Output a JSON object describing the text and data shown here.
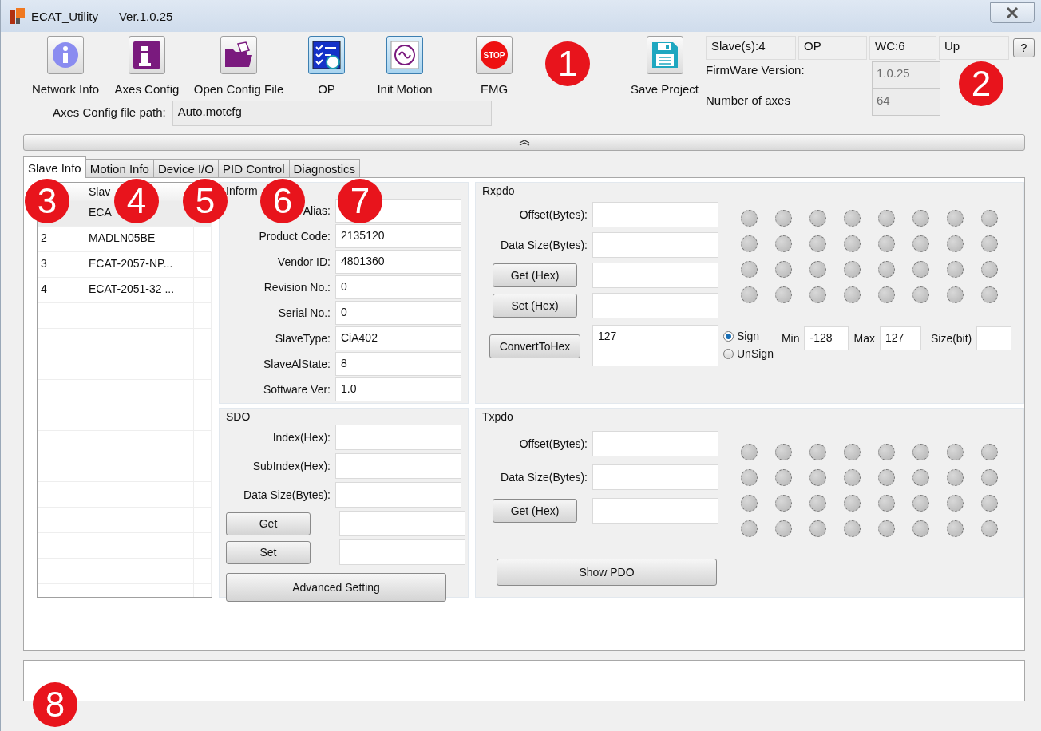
{
  "window": {
    "title": "ECAT_Utility",
    "version": "Ver.1.0.25"
  },
  "toolbar": [
    {
      "label": "Network Info",
      "active": false
    },
    {
      "label": "Axes Config",
      "active": false
    },
    {
      "label": "Open Config File",
      "active": false
    },
    {
      "label": "OP",
      "active": true
    },
    {
      "label": "Init Motion",
      "active": true
    },
    {
      "label": "EMG",
      "icon_text": "STOP",
      "active": false
    }
  ],
  "save": {
    "label": "Save Project"
  },
  "config_path": {
    "label": "Axes Config file path:",
    "value": "Auto.motcfg"
  },
  "status": {
    "cells": [
      "Slave(s):4",
      "OP",
      "WC:6",
      "Up"
    ],
    "help": "?",
    "firmware": {
      "label": "FirmWare Version:",
      "value": "1.0.25",
      "disabled": true
    },
    "axes": {
      "label": "Number of axes",
      "value": "64",
      "disabled": true
    }
  },
  "tabs": [
    {
      "label": "Slave Info",
      "selected": true
    },
    {
      "label": "Motion Info",
      "selected": false
    },
    {
      "label": "Device I/O",
      "selected": false
    },
    {
      "label": "PID Control",
      "selected": false
    },
    {
      "label": "Diagnostics",
      "selected": false
    }
  ],
  "slave_table": {
    "columns": [
      "Slav"
    ],
    "rows": [
      {
        "name": "ECA",
        "selected": true
      },
      {
        "number": "2",
        "name": "MADLN05BE",
        "selected": false
      },
      {
        "number": "3",
        "name": "ECAT-2057-NP...",
        "selected": false
      },
      {
        "number": "4",
        "name": "ECAT-2051-32 ...",
        "selected": false
      }
    ]
  },
  "info": {
    "title": "Inform",
    "fields": [
      {
        "label": "Alias:"
      },
      {
        "label": "Product Code:",
        "value": "2135120"
      },
      {
        "label": "Vendor ID:",
        "value": "4801360"
      },
      {
        "label": "Revision No.:",
        "value": "0"
      },
      {
        "label": "Serial No.:",
        "value": "0"
      },
      {
        "label": "SlaveType:",
        "value": "CiA402"
      },
      {
        "label": "SlaveAlState:",
        "value": "8"
      },
      {
        "label": "Software Ver:",
        "value": "1.0"
      }
    ]
  },
  "sdo": {
    "title": "SDO",
    "rows": [
      {
        "kind": "field",
        "label": "Index(Hex):"
      },
      {
        "kind": "field",
        "label": "SubIndex(Hex):"
      },
      {
        "kind": "field",
        "label": "Data Size(Bytes):"
      },
      {
        "kind": "button",
        "label": "Get"
      },
      {
        "kind": "button",
        "label": "Set"
      }
    ],
    "action": "Advanced Setting"
  },
  "rxpdo": {
    "title": "Rxpdo",
    "rows": [
      {
        "kind": "field",
        "label": "Offset(Bytes):"
      },
      {
        "kind": "field",
        "label": "Data Size(Bytes):"
      },
      {
        "kind": "button",
        "label": "Get (Hex)"
      },
      {
        "kind": "button",
        "label": "Set (Hex)"
      }
    ],
    "convert": {
      "label": "ConvertToHex",
      "value": "127"
    },
    "signs": [
      {
        "label": "Sign",
        "selected": true
      },
      {
        "label": "UnSign",
        "selected": false
      }
    ],
    "min": {
      "label": "Min",
      "value": "-128"
    },
    "max": {
      "label": "Max",
      "value": "127"
    },
    "size": {
      "label": "Size(bit)"
    },
    "leds": [
      [
        false,
        false,
        false,
        false,
        false,
        false,
        false,
        false
      ],
      [
        false,
        false,
        false,
        false,
        false,
        false,
        false,
        false
      ],
      [
        false,
        false,
        false,
        false,
        false,
        false,
        false,
        false
      ],
      [
        false,
        false,
        false,
        false,
        false,
        false,
        false,
        false
      ]
    ]
  },
  "txpdo": {
    "title": "Txpdo",
    "rows": [
      {
        "kind": "field",
        "label": "Offset(Bytes):"
      },
      {
        "kind": "field",
        "label": "Data Size(Bytes):"
      },
      {
        "kind": "button",
        "label": "Get (Hex)"
      }
    ],
    "action": "Show PDO",
    "leds": [
      [
        false,
        false,
        false,
        false,
        false,
        false,
        false,
        false
      ],
      [
        false,
        false,
        false,
        false,
        false,
        false,
        false,
        false
      ],
      [
        false,
        false,
        false,
        false,
        false,
        false,
        false,
        false
      ],
      [
        false,
        false,
        false,
        false,
        false,
        false,
        false,
        false
      ]
    ]
  },
  "callouts": [
    "1",
    "2",
    "3",
    "4",
    "5",
    "6",
    "7",
    "8"
  ]
}
